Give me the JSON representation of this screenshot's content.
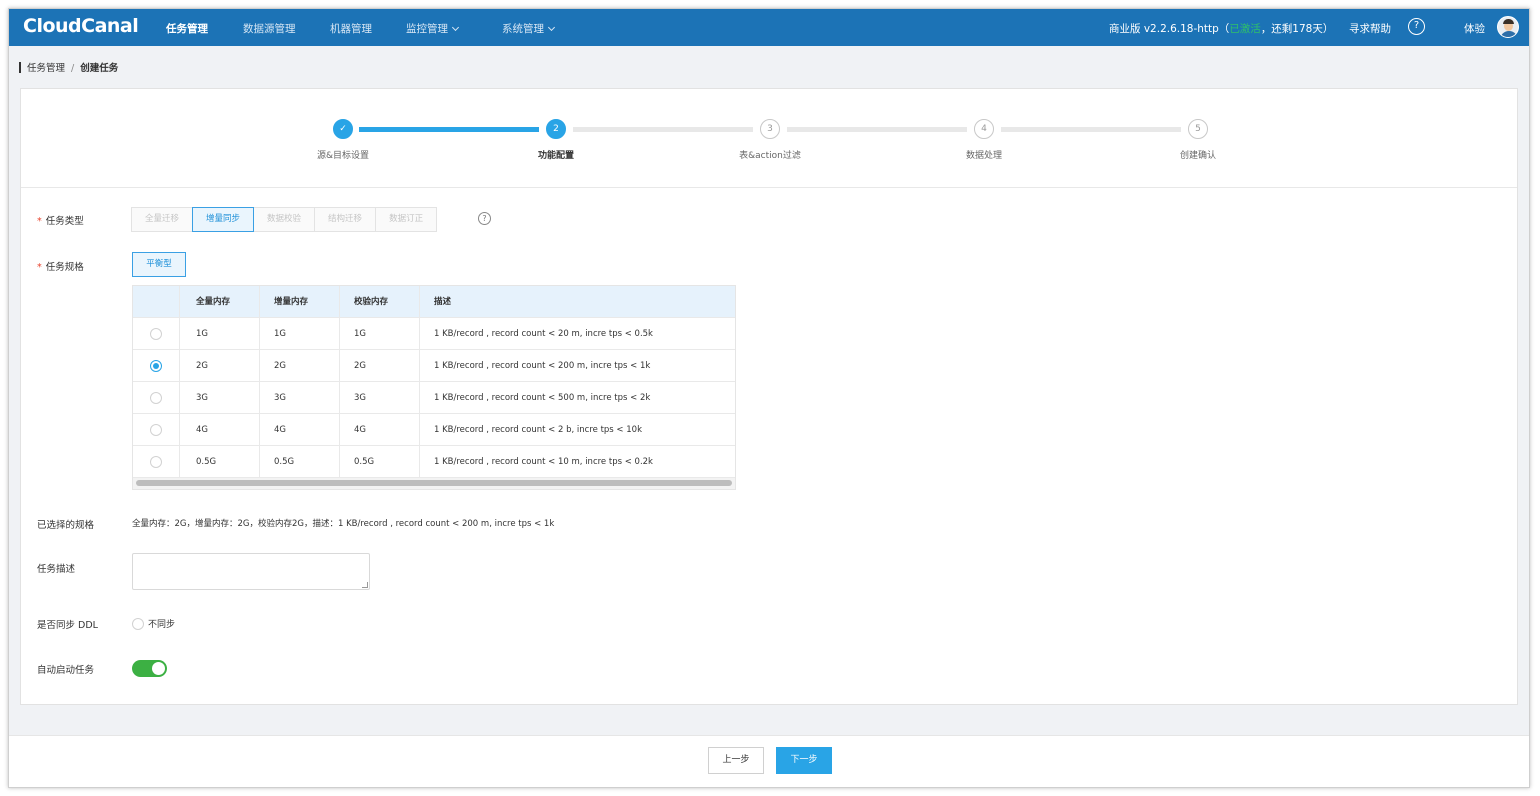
{
  "app": {
    "logo": "CloudCanal"
  },
  "nav": {
    "items": [
      {
        "label": "任务管理",
        "active": true
      },
      {
        "label": "数据源管理",
        "active": false
      },
      {
        "label": "机器管理",
        "active": false
      },
      {
        "label": "监控管理",
        "active": false,
        "dropdown": true
      },
      {
        "label": "系统管理",
        "active": false,
        "dropdown": true
      }
    ],
    "version_prefix": "商业版 v2.2.6.18-http（",
    "version_status": "已激活",
    "version_suffix": "，还剩178天）",
    "help_label": "寻求帮助",
    "help_icon": "?",
    "user_label": "体验"
  },
  "breadcrumb": {
    "parent": "任务管理",
    "separator": "/",
    "current": "创建任务"
  },
  "steps": [
    {
      "num": "✓",
      "label": "源&目标设置",
      "state": "done"
    },
    {
      "num": "2",
      "label": "功能配置",
      "state": "active"
    },
    {
      "num": "3",
      "label": "表&action过滤",
      "state": "todo"
    },
    {
      "num": "4",
      "label": "数据处理",
      "state": "todo"
    },
    {
      "num": "5",
      "label": "创建确认",
      "state": "todo"
    }
  ],
  "form": {
    "task_type": {
      "label": "任务类型",
      "options": [
        "全量迁移",
        "增量同步",
        "数据校验",
        "结构迁移",
        "数据订正"
      ],
      "selected": "增量同步",
      "help_icon": "?"
    },
    "task_spec": {
      "label": "任务规格",
      "tab": "平衡型",
      "columns": [
        "全量内存",
        "增量内存",
        "校验内存",
        "描述"
      ],
      "rows": [
        {
          "full": "1G",
          "incr": "1G",
          "check": "1G",
          "desc": "1 KB/record , record count < 20 m, incre tps < 0.5k",
          "selected": false
        },
        {
          "full": "2G",
          "incr": "2G",
          "check": "2G",
          "desc": "1 KB/record , record count < 200 m, incre tps < 1k",
          "selected": true
        },
        {
          "full": "3G",
          "incr": "3G",
          "check": "3G",
          "desc": "1 KB/record , record count < 500 m, incre tps < 2k",
          "selected": false
        },
        {
          "full": "4G",
          "incr": "4G",
          "check": "4G",
          "desc": "1 KB/record , record count < 2 b, incre tps < 10k",
          "selected": false
        },
        {
          "full": "0.5G",
          "incr": "0.5G",
          "check": "0.5G",
          "desc": "1 KB/record , record count < 10 m, incre tps < 0.2k",
          "selected": false
        }
      ]
    },
    "selected_spec": {
      "label": "已选择的规格",
      "value": "全量内存：2G，增量内存：2G，校验内存2G，描述：1 KB/record , record count < 200 m, incre tps < 1k"
    },
    "task_desc": {
      "label": "任务描述",
      "value": ""
    },
    "ddl_sync": {
      "label": "是否同步 DDL",
      "option": "不同步",
      "checked": false
    },
    "auto_start": {
      "label": "自动启动任务",
      "enabled": true
    }
  },
  "footer": {
    "prev_label": "上一步",
    "next_label": "下一步"
  },
  "colors": {
    "nav_bg": "#1c73b6",
    "accent": "#29a4e6",
    "toggle_on": "#3cb043",
    "activated": "#2fc06a"
  }
}
